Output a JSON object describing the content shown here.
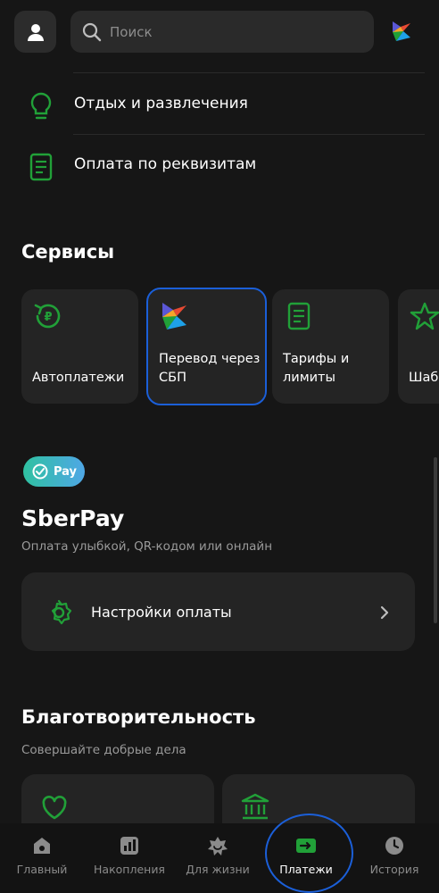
{
  "header": {
    "search_placeholder": "Поиск"
  },
  "menu": [
    {
      "label": "Отдых и развлечения",
      "icon": "lightbulb-icon"
    },
    {
      "label": "Оплата по реквизитам",
      "icon": "document-icon"
    }
  ],
  "services": {
    "title": "Сервисы",
    "items": [
      {
        "label": "Автоплатежи",
        "icon": "autopay-icon"
      },
      {
        "label": "Перевод через СБП",
        "icon": "sbp-icon",
        "selected": true
      },
      {
        "label": "Тарифы и лимиты",
        "icon": "document-icon"
      },
      {
        "label": "Шаб",
        "icon": "star-icon"
      }
    ]
  },
  "sberpay": {
    "badge": "Pay",
    "title": "SberPay",
    "subtitle": "Оплата улыбкой, QR-кодом или онлайн",
    "settings_label": "Настройки оплаты"
  },
  "charity": {
    "title": "Благотворительность",
    "subtitle": "Совершайте добрые дела",
    "cards": [
      {
        "icon": "heart-icon"
      },
      {
        "icon": "bank-icon"
      }
    ]
  },
  "tabs": [
    {
      "label": "Главный",
      "icon": "home-icon",
      "active": false
    },
    {
      "label": "Накопления",
      "icon": "chart-icon",
      "active": false
    },
    {
      "label": "Для жизни",
      "icon": "lifestyle-icon",
      "active": false
    },
    {
      "label": "Платежи",
      "icon": "payments-icon",
      "active": true
    },
    {
      "label": "История",
      "icon": "clock-icon",
      "active": false
    }
  ],
  "colors": {
    "background": "#161616",
    "card": "#242424",
    "accent_green": "#21a038",
    "selection_blue": "#1b5fd8"
  }
}
